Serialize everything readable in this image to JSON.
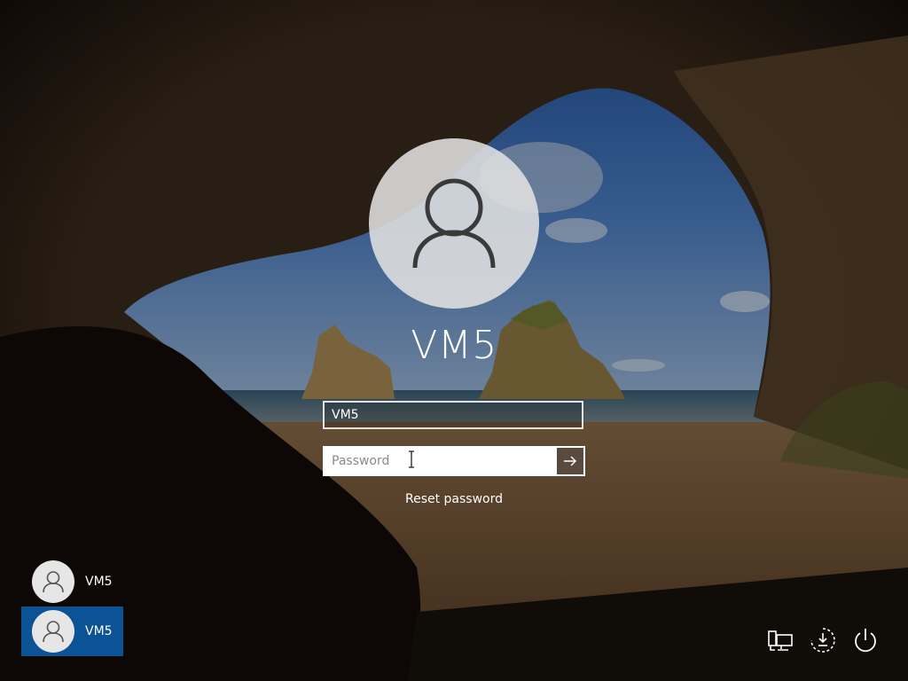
{
  "login": {
    "display_name": "VM5",
    "username_value": "VM5",
    "password_placeholder": "Password",
    "submit_icon": "arrow-right-icon",
    "reset_label": "Reset password"
  },
  "user_switcher": {
    "users": [
      {
        "label": "VM5",
        "selected": false
      },
      {
        "label": "VM5",
        "selected": true
      }
    ]
  },
  "system_icons": {
    "network": "network-icon",
    "ease_of_access": "ease-of-access-icon",
    "power": "power-icon"
  },
  "colors": {
    "selected_tile": "#0b5394",
    "submit_button": "#5a4a3e"
  }
}
